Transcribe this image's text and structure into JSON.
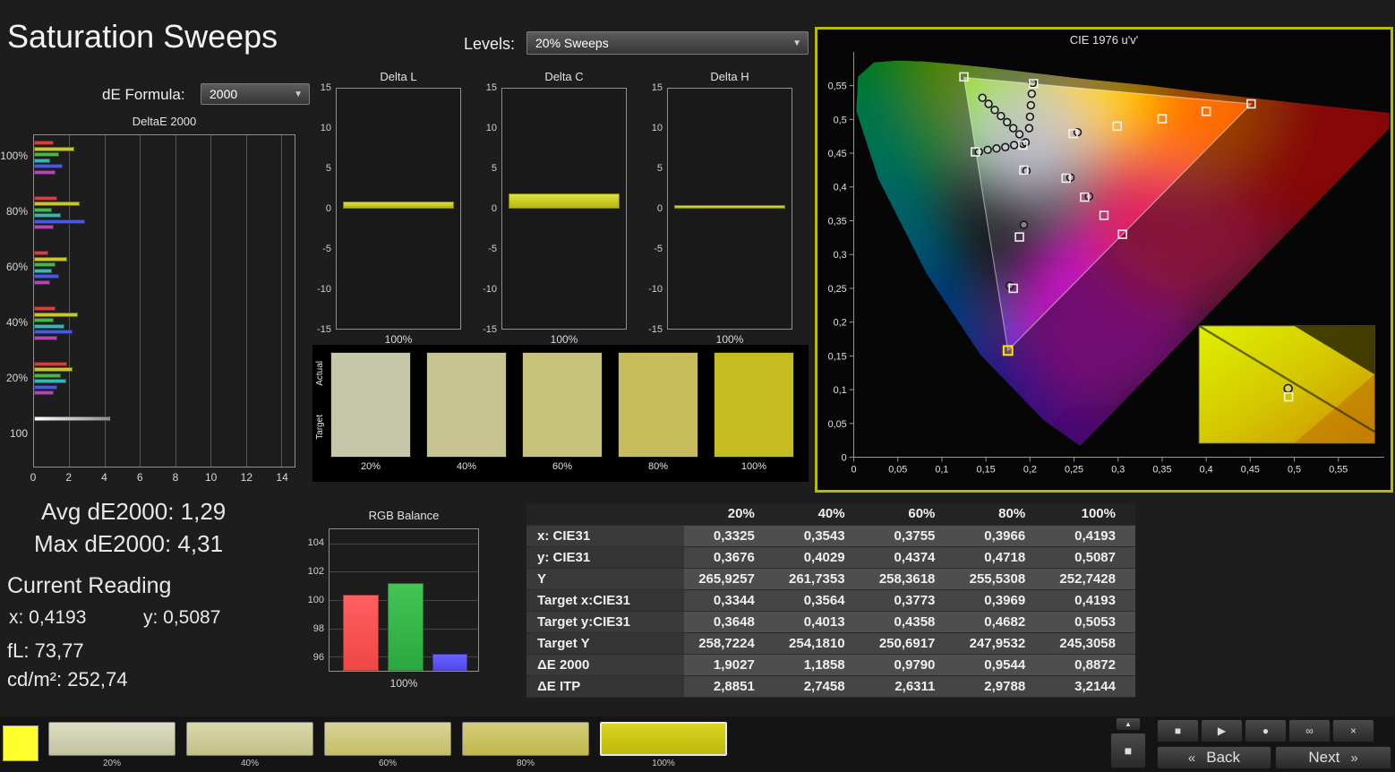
{
  "page": {
    "title": "Saturation Sweeps"
  },
  "controls": {
    "de_formula_label": "dE Formula:",
    "de_formula_value": "2000",
    "levels_label": "Levels:",
    "levels_value": "20% Sweeps"
  },
  "stats": {
    "avg": "Avg dE2000: 1,29",
    "max": "Max dE2000: 4,31",
    "current_reading_label": "Current Reading",
    "x": "x: 0,4193",
    "y": "y: 0,5087",
    "fl": "fL: 73,77",
    "cdm2": "cd/m²: 252,74"
  },
  "charts": {
    "deltae": {
      "title": "DeltaE 2000",
      "x_ticks": [
        0,
        2,
        4,
        6,
        8,
        10,
        12,
        14
      ],
      "x_max": 14.75,
      "groups": [
        {
          "label": "100%",
          "bars": [
            {
              "color": "#d24040",
              "value": 1.1
            },
            {
              "color": "#c6c832",
              "value": 2.3
            },
            {
              "color": "#49b649",
              "value": 1.4
            },
            {
              "color": "#3ab4b4",
              "value": 0.9
            },
            {
              "color": "#4a5ae0",
              "value": 1.6
            },
            {
              "color": "#b04ab0",
              "value": 1.2
            }
          ]
        },
        {
          "label": "80%",
          "bars": [
            {
              "color": "#d24040",
              "value": 1.3
            },
            {
              "color": "#c6c832",
              "value": 2.6
            },
            {
              "color": "#49b649",
              "value": 1.0
            },
            {
              "color": "#3ab4b4",
              "value": 1.5
            },
            {
              "color": "#4a5ae0",
              "value": 2.9
            },
            {
              "color": "#b04ab0",
              "value": 1.1
            }
          ]
        },
        {
          "label": "60%",
          "bars": [
            {
              "color": "#d24040",
              "value": 0.8
            },
            {
              "color": "#c6c832",
              "value": 1.9
            },
            {
              "color": "#49b649",
              "value": 1.2
            },
            {
              "color": "#3ab4b4",
              "value": 1.0
            },
            {
              "color": "#4a5ae0",
              "value": 1.4
            },
            {
              "color": "#b04ab0",
              "value": 0.9
            }
          ]
        },
        {
          "label": "40%",
          "bars": [
            {
              "color": "#d24040",
              "value": 1.2
            },
            {
              "color": "#c6c832",
              "value": 2.5
            },
            {
              "color": "#49b649",
              "value": 1.1
            },
            {
              "color": "#3ab4b4",
              "value": 1.7
            },
            {
              "color": "#4a5ae0",
              "value": 2.2
            },
            {
              "color": "#b04ab0",
              "value": 1.3
            }
          ]
        },
        {
          "label": "20%",
          "bars": [
            {
              "color": "#d24040",
              "value": 1.9
            },
            {
              "color": "#c6c832",
              "value": 2.2
            },
            {
              "color": "#49b649",
              "value": 1.5
            },
            {
              "color": "#3ab4b4",
              "value": 1.8
            },
            {
              "color": "#4a5ae0",
              "value": 1.3
            },
            {
              "color": "#b04ab0",
              "value": 1.1
            }
          ]
        },
        {
          "label": "100",
          "bars": [
            {
              "color": "#dcdcdc",
              "value": 4.31
            }
          ]
        }
      ]
    },
    "delta_axis": {
      "ticks": [
        15,
        10,
        5,
        0,
        -5,
        -10,
        -15
      ],
      "x_label": "100%",
      "y_max": 15
    },
    "delta_l": {
      "title": "Delta L",
      "value": 0.9
    },
    "delta_c": {
      "title": "Delta C",
      "value": 1.9
    },
    "delta_h": {
      "title": "Delta H",
      "value": 0.4
    },
    "rgb_balance": {
      "title": "RGB Balance",
      "y_ticks": [
        104,
        102,
        100,
        98,
        96
      ],
      "y_min": 95,
      "y_max": 105,
      "x_label": "100%",
      "bars": [
        {
          "name": "red",
          "color_top": "#ff6060",
          "color": "#ef4646",
          "value": 100.4
        },
        {
          "name": "green",
          "color_top": "#44c455",
          "color": "#2aa83e",
          "value": 101.2
        },
        {
          "name": "blue",
          "color_top": "#6a62ff",
          "color": "#5048e8",
          "value": 96.2
        }
      ]
    }
  },
  "swatch_panel": {
    "actual_label": "Actual",
    "target_label": "Target",
    "swatches": [
      {
        "label": "20%",
        "color": "#c6c6a8"
      },
      {
        "label": "40%",
        "color": "#c7c492"
      },
      {
        "label": "60%",
        "color": "#c8c37b"
      },
      {
        "label": "80%",
        "color": "#c7bd5c"
      },
      {
        "label": "100%",
        "color": "#c4bc20"
      }
    ]
  },
  "cie": {
    "title": "CIE 1976 u'v'",
    "x_tick_labels": [
      "0",
      "0,05",
      "0,1",
      "0,15",
      "0,2",
      "0,25",
      "0,3",
      "0,35",
      "0,4",
      "0,45",
      "0,5",
      "0,55"
    ],
    "y_tick_labels": [
      "0",
      "0,05",
      "0,1",
      "0,15",
      "0,2",
      "0,25",
      "0,3",
      "0,35",
      "0,4",
      "0,45",
      "0,5",
      "0,55"
    ],
    "markers": {
      "squares": [
        [
          0.125,
          0.563
        ],
        [
          0.204,
          0.553
        ],
        [
          0.249,
          0.479
        ],
        [
          0.299,
          0.49
        ],
        [
          0.35,
          0.501
        ],
        [
          0.4,
          0.512
        ],
        [
          0.451,
          0.523
        ],
        [
          0.241,
          0.413
        ],
        [
          0.262,
          0.385
        ],
        [
          0.284,
          0.358
        ],
        [
          0.305,
          0.33
        ],
        [
          0.193,
          0.425
        ],
        [
          0.188,
          0.326
        ],
        [
          0.181,
          0.25
        ],
        [
          0.138,
          0.452
        ],
        [
          0.192,
          0.462
        ]
      ],
      "highlight_square": [
        0.175,
        0.158
      ],
      "circles": [
        [
          0.146,
          0.532
        ],
        [
          0.153,
          0.523
        ],
        [
          0.16,
          0.514
        ],
        [
          0.167,
          0.505
        ],
        [
          0.174,
          0.496
        ],
        [
          0.181,
          0.487
        ],
        [
          0.188,
          0.478
        ],
        [
          0.199,
          0.487
        ],
        [
          0.2,
          0.504
        ],
        [
          0.201,
          0.521
        ],
        [
          0.202,
          0.538
        ],
        [
          0.203,
          0.554
        ],
        [
          0.142,
          0.452
        ],
        [
          0.152,
          0.455
        ],
        [
          0.162,
          0.457
        ],
        [
          0.172,
          0.459
        ],
        [
          0.182,
          0.462
        ],
        [
          0.192,
          0.464
        ],
        [
          0.196,
          0.424
        ],
        [
          0.193,
          0.344
        ],
        [
          0.177,
          0.254
        ],
        [
          0.246,
          0.414
        ],
        [
          0.267,
          0.386
        ],
        [
          0.254,
          0.481
        ],
        [
          0.195,
          0.466
        ]
      ]
    }
  },
  "table": {
    "columns": [
      "20%",
      "40%",
      "60%",
      "80%",
      "100%"
    ],
    "rows": [
      {
        "label": "x: CIE31",
        "values": [
          "0,3325",
          "0,3543",
          "0,3755",
          "0,3966",
          "0,4193"
        ]
      },
      {
        "label": "y: CIE31",
        "values": [
          "0,3676",
          "0,4029",
          "0,4374",
          "0,4718",
          "0,5087"
        ]
      },
      {
        "label": "Y",
        "values": [
          "265,9257",
          "261,7353",
          "258,3618",
          "255,5308",
          "252,7428"
        ]
      },
      {
        "label": "Target x:CIE31",
        "values": [
          "0,3344",
          "0,3564",
          "0,3773",
          "0,3969",
          "0,4193"
        ]
      },
      {
        "label": "Target y:CIE31",
        "values": [
          "0,3648",
          "0,4013",
          "0,4358",
          "0,4682",
          "0,5053"
        ]
      },
      {
        "label": "Target Y",
        "values": [
          "258,7224",
          "254,1810",
          "250,6917",
          "247,9532",
          "245,3058"
        ]
      },
      {
        "label": "ΔE 2000",
        "values": [
          "1,9027",
          "1,1858",
          "0,9790",
          "0,9544",
          "0,8872"
        ]
      },
      {
        "label": "ΔE ITP",
        "values": [
          "2,8851",
          "2,7458",
          "2,6311",
          "2,9788",
          "3,2144"
        ]
      }
    ]
  },
  "bottom": {
    "tiles": [
      {
        "label": "20%",
        "top": "#dedec6",
        "bottom": "#c2c29e",
        "selected": false
      },
      {
        "label": "40%",
        "top": "#dbd8ac",
        "bottom": "#c3bf88",
        "selected": false
      },
      {
        "label": "60%",
        "top": "#d8d396",
        "bottom": "#c4be6a",
        "selected": false
      },
      {
        "label": "80%",
        "top": "#d4cd7a",
        "bottom": "#c1b74c",
        "selected": false
      },
      {
        "label": "100%",
        "top": "#d9d520",
        "bottom": "#bdb90e",
        "selected": true
      }
    ],
    "transport": [
      {
        "name": "stop-button",
        "glyph": "■"
      },
      {
        "name": "play-button",
        "glyph": "▶"
      },
      {
        "name": "record-button",
        "glyph": "●"
      },
      {
        "name": "loop-button",
        "glyph": "∞"
      },
      {
        "name": "close-button",
        "glyph": "×"
      }
    ],
    "back_label": "Back",
    "next_label": "Next",
    "back_chevron": "«",
    "next_chevron": "»",
    "expand_glyph": "▲",
    "stop_big_glyph": "■"
  }
}
